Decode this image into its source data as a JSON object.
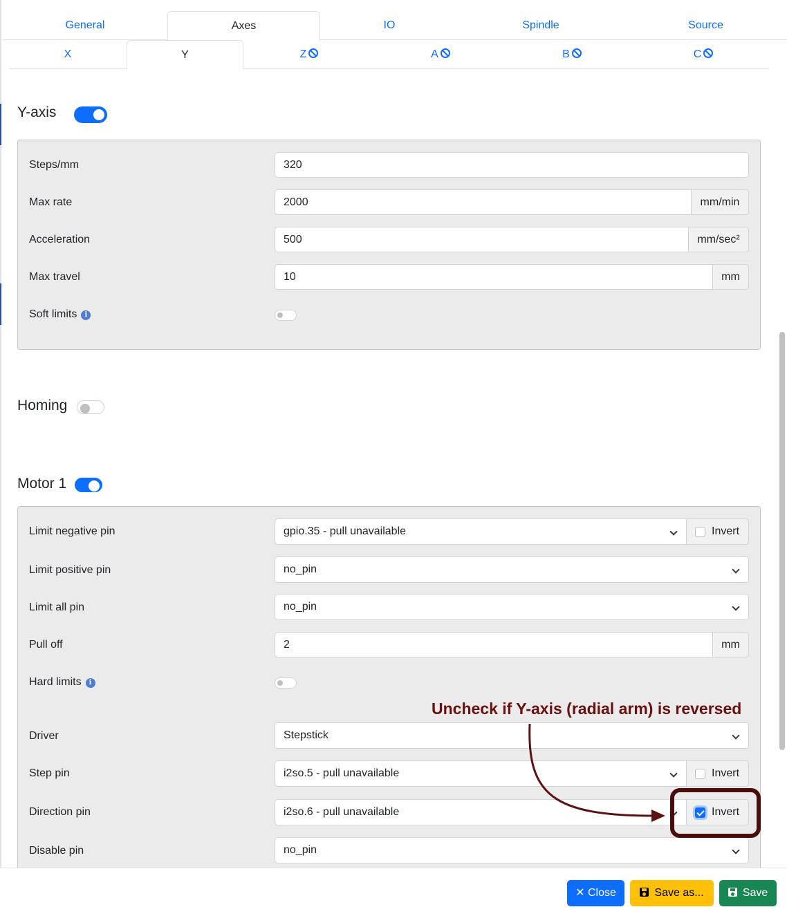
{
  "main_tabs": [
    {
      "label": "General",
      "active": false
    },
    {
      "label": "Axes",
      "active": true
    },
    {
      "label": "IO",
      "active": false
    },
    {
      "label": "Spindle",
      "active": false
    },
    {
      "label": "Source",
      "active": false
    }
  ],
  "axis_tabs": [
    {
      "label": "X",
      "active": false,
      "disabled_icon": false
    },
    {
      "label": "Y",
      "active": true,
      "disabled_icon": false
    },
    {
      "label": "Z",
      "active": false,
      "disabled_icon": true
    },
    {
      "label": "A",
      "active": false,
      "disabled_icon": true
    },
    {
      "label": "B",
      "active": false,
      "disabled_icon": true
    },
    {
      "label": "C",
      "active": false,
      "disabled_icon": true
    }
  ],
  "axis_section": {
    "title": "Y-axis",
    "enabled": true,
    "fields": {
      "steps_label": "Steps/mm",
      "steps_value": "320",
      "max_rate_label": "Max rate",
      "max_rate_value": "2000",
      "max_rate_unit": "mm/min",
      "accel_label": "Acceleration",
      "accel_value": "500",
      "accel_unit": "mm/sec²",
      "max_travel_label": "Max travel",
      "max_travel_value": "10",
      "max_travel_unit": "mm",
      "soft_limits_label": "Soft limits",
      "soft_limits_on": false
    }
  },
  "homing": {
    "title": "Homing",
    "enabled": false
  },
  "motor": {
    "title": "Motor 1",
    "enabled": true,
    "fields": {
      "limit_neg_label": "Limit negative pin",
      "limit_neg_value": "gpio.35 - pull unavailable",
      "limit_neg_invert": false,
      "limit_pos_label": "Limit positive pin",
      "limit_pos_value": "no_pin",
      "limit_all_label": "Limit all pin",
      "limit_all_value": "no_pin",
      "pull_off_label": "Pull off",
      "pull_off_value": "2",
      "pull_off_unit": "mm",
      "hard_limits_label": "Hard limits",
      "hard_limits_on": false,
      "driver_label": "Driver",
      "driver_value": "Stepstick",
      "step_pin_label": "Step pin",
      "step_pin_value": "i2so.5 - pull unavailable",
      "step_pin_invert": false,
      "dir_pin_label": "Direction pin",
      "dir_pin_value": "i2so.6 - pull unavailable",
      "dir_pin_invert": true,
      "disable_pin_label": "Disable pin",
      "disable_pin_value": "no_pin"
    }
  },
  "invert_label": "Invert",
  "annotation": {
    "text": "Uncheck if Y-axis (radial arm) is reversed",
    "color": "#6b1010"
  },
  "footer": {
    "close_label": "Close",
    "save_as_label": "Save as...",
    "save_label": "Save"
  },
  "colors": {
    "primary": "#0d6efd",
    "warning": "#ffc107",
    "success": "#198754",
    "panel_bg": "#ebebeb"
  }
}
